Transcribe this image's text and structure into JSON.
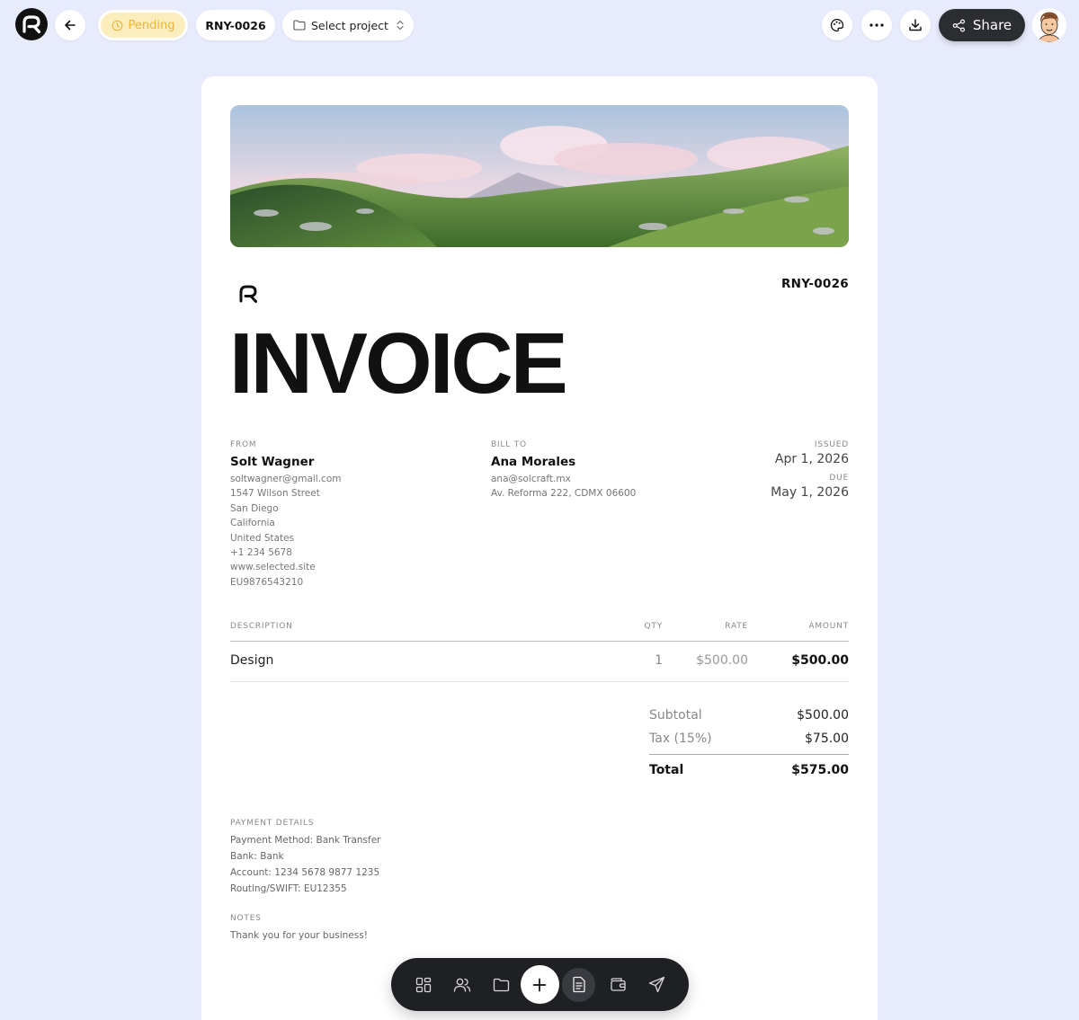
{
  "topbar": {
    "status": "Pending",
    "invoice_number": "RNY-0026",
    "project_select": "Select project",
    "share_label": "Share"
  },
  "invoice": {
    "number": "RNY-0026",
    "title": "INVOICE",
    "from": {
      "label": "FROM",
      "name": "Solt Wagner",
      "lines": [
        "soltwagner@gmail.com",
        "1547 Wilson Street",
        "San Diego",
        "California",
        "United States",
        "+1 234 5678",
        "www.selected.site",
        "EU9876543210"
      ]
    },
    "bill_to": {
      "label": "BILL TO",
      "name": "Ana Morales",
      "lines": [
        "ana@solcraft.mx",
        "Av. Reforma 222, CDMX 06600"
      ]
    },
    "issued_label": "ISSUED",
    "issued": "Apr 1, 2026",
    "due_label": "DUE",
    "due": "May 1, 2026",
    "table": {
      "headers": {
        "description": "DESCRIPTION",
        "qty": "QTY",
        "rate": "RATE",
        "amount": "AMOUNT"
      },
      "rows": [
        {
          "description": "Design",
          "qty": "1",
          "rate": "$500.00",
          "amount": "$500.00"
        }
      ]
    },
    "totals": {
      "subtotal_label": "Subtotal",
      "subtotal": "$500.00",
      "tax_label": "Tax (15%)",
      "tax": "$75.00",
      "total_label": "Total",
      "total": "$575.00"
    },
    "payment": {
      "label": "PAYMENT DETAILS",
      "lines": [
        "Payment Method: Bank Transfer",
        "Bank: Bank",
        "Account: 1234 5678 9877 1235",
        "Routing/SWIFT: EU12355"
      ]
    },
    "notes": {
      "label": "NOTES",
      "text": "Thank you for your business!"
    }
  },
  "dock": {
    "items": [
      "dashboard-icon",
      "clients-icon",
      "folder-icon",
      "add-icon",
      "invoice-icon",
      "wallet-icon",
      "send-icon"
    ],
    "active": "invoice-icon"
  },
  "colors": {
    "background": "#e7ebfb",
    "pending_bg": "#fbeebc",
    "pending_text": "#f0b43a",
    "dark": "#1f2023"
  }
}
